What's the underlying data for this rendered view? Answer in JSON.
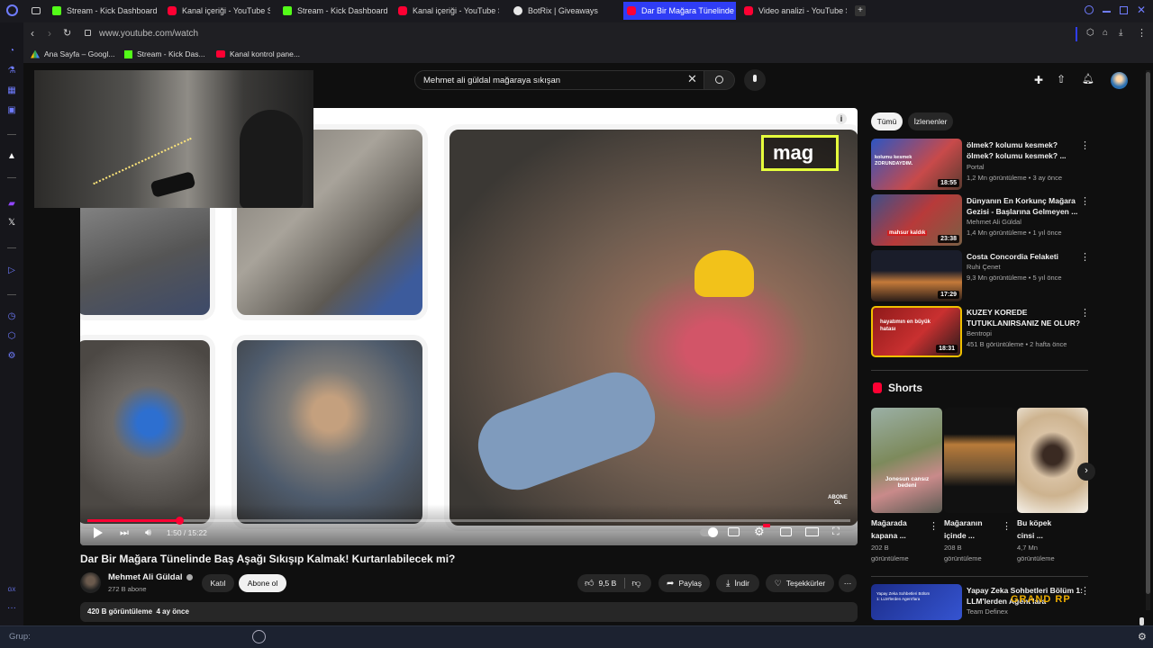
{
  "browser": {
    "tabs": [
      {
        "label": "Stream - Kick Dashboard",
        "color": "#53fc18"
      },
      {
        "label": "Kanal içeriği - YouTube St",
        "color": "#ff0033"
      },
      {
        "label": "Stream - Kick Dashboard",
        "color": "#53fc18"
      },
      {
        "label": "Kanal içeriği - YouTube St",
        "color": "#ff0033"
      },
      {
        "label": "BotRix | Giveaways",
        "color": "#ffffff"
      },
      {
        "label": "Dar Bir Mağara Tünelinde",
        "color": "#ff0033"
      },
      {
        "label": "Video analizi - YouTube St",
        "color": "#ff0033"
      }
    ],
    "url": "www.youtube.com/watch",
    "bookmarks": [
      {
        "label": "Ana Sayfa – Googl..."
      },
      {
        "label": "Stream - Kick Das..."
      },
      {
        "label": "Kanal kontrol pane..."
      }
    ]
  },
  "youtube": {
    "search_query": "Mehmet ali güldal mağaraya sıkışan",
    "player": {
      "overlay_text": "mag",
      "time": "1:50 / 15:22",
      "progress": 0.12,
      "watermark": "ABONE OL"
    },
    "video": {
      "title": "Dar Bir Mağara Tünelinde Baş Aşağı Sıkışıp Kalmak! Kurtarılabilecek mi?",
      "channel": "Mehmet Ali Güldal",
      "subscribers": "272 B abone",
      "join_label": "Katıl",
      "subscribe_label": "Abone ol",
      "likes": "9,5 B",
      "share_label": "Paylaş",
      "download_label": "İndir",
      "thanks_label": "Teşekkürler",
      "views_date": "420 B görüntüleme  4 ay önce"
    },
    "filters": [
      "Tümü",
      "İzlenenler"
    ],
    "recommendations": [
      {
        "title_line1": "ölmek? kolumu kesmek?",
        "title_line2": "ölmek? kolumu kesmek? ...",
        "channel": "Portal",
        "meta": "1,2 Mn görüntüleme • 3 ay önce",
        "duration": "18:55",
        "thumb_text": "kolumu kesmek ZORUNDAYDIM."
      },
      {
        "title_line1": "Dünyanın En Korkunç Mağara",
        "title_line2": "Gezisi - Başlarına Gelmeyen ...",
        "channel": "Mehmet Ali Güldal",
        "meta": "1,4 Mn görüntüleme • 1 yıl önce",
        "duration": "23:38",
        "thumb_text": "mahsur kaldık"
      },
      {
        "title_line1": "Costa Concordia Felaketi",
        "title_line2": "",
        "channel": "Ruhi Çenet",
        "meta": "9,3 Mn görüntüleme • 5 yıl önce",
        "duration": "17:29",
        "thumb_text": ""
      },
      {
        "title_line1": "KUZEY KOREDE",
        "title_line2": "TUTUKLANIRSANIZ NE OLUR?",
        "channel": "Bentropi",
        "meta": "451 B görüntüleme • 2 hafta önce",
        "duration": "18:31",
        "thumb_text": "hayatımın en büyük hatası"
      }
    ],
    "shorts_header": "Shorts",
    "shorts": [
      {
        "title_line1": "Mağarada",
        "title_line2": "kapana ...",
        "views_line1": "202 B",
        "views_line2": "görüntüleme",
        "thumb_text": "Jonesun cansız bedeni"
      },
      {
        "title_line1": "Mağaranın",
        "title_line2": "içinde ...",
        "views_line1": "208 B",
        "views_line2": "görüntüleme",
        "thumb_text": ""
      },
      {
        "title_line1": "Bu köpek",
        "title_line2": "cinsi ...",
        "views_line1": "4,7 Mn",
        "views_line2": "görüntüleme",
        "thumb_text": ""
      }
    ],
    "bottom_rec": {
      "title_line1": "Yapay Zeka Sohbetleri Bölüm 1:",
      "title_line2": "LLM'lerden Agent'lara",
      "channel": "Team Definex",
      "thumb_text": "Yapay Zeka Sohbetleri Bölüm 1: LLM'lerden Agent'lara"
    },
    "overlay_logo": "GRAND RP"
  },
  "taskbar": {
    "label": "Grup:"
  }
}
